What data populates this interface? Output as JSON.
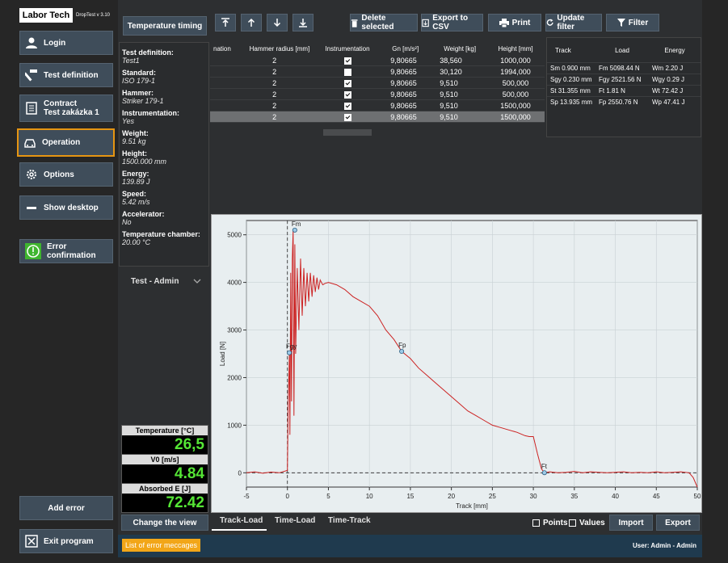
{
  "app": {
    "logo": "Labor Tech",
    "version": "DropTest v 3.10"
  },
  "nav": {
    "login": "Login",
    "test_definition": "Test definition",
    "contract_line1": "Contract",
    "contract_line2": "Test zakázka 1",
    "operation": "Operation",
    "options": "Options",
    "show_desktop": "Show desktop",
    "error_confirmation": "Error confirmation",
    "add_error": "Add error",
    "exit_program": "Exit program"
  },
  "toolbar": {
    "temperature_timing": "Temperature timing",
    "delete_selected": "Delete selected",
    "export_csv": "Export to CSV",
    "print": "Print",
    "update_filter": "Update filter",
    "filter": "Filter"
  },
  "test_info": [
    {
      "label": "Test definition:",
      "value": "Test1"
    },
    {
      "label": "Standard:",
      "value": "ISO 179-1"
    },
    {
      "label": "Hammer:",
      "value": "Striker 179-1"
    },
    {
      "label": "Instrumentation:",
      "value": "Yes"
    },
    {
      "label": "Weight:",
      "value": "9.51   kg"
    },
    {
      "label": "Height:",
      "value": "1500.000   mm"
    },
    {
      "label": "Energy:",
      "value": "139.89   J"
    },
    {
      "label": "Speed:",
      "value": "5.42   m/s"
    },
    {
      "label": "Accelerator:",
      "value": "No"
    },
    {
      "label": "Temperature chamber:",
      "value": "20.00 °C"
    }
  ],
  "user_select": "Test - Admin",
  "table": {
    "headers": [
      "nation",
      "Hammer radius [mm]",
      "Instrumentation",
      "Gn [m/s²]",
      "Weight [kg]",
      "Height [mm]"
    ],
    "rows": [
      {
        "radius": "2",
        "instr": true,
        "gn": "9,80665",
        "weight": "38,560",
        "height": "1000,000"
      },
      {
        "radius": "2",
        "instr": false,
        "gn": "9,80665",
        "weight": "30,120",
        "height": "1994,000"
      },
      {
        "radius": "2",
        "instr": true,
        "gn": "9,80665",
        "weight": "9,510",
        "height": "500,000"
      },
      {
        "radius": "2",
        "instr": true,
        "gn": "9,80665",
        "weight": "9,510",
        "height": "500,000"
      },
      {
        "radius": "2",
        "instr": true,
        "gn": "9,80665",
        "weight": "9,510",
        "height": "1500,000"
      },
      {
        "radius": "2",
        "instr": true,
        "gn": "9,80665",
        "weight": "9,510",
        "height": "1500,000"
      }
    ]
  },
  "results": {
    "headers": [
      "Track",
      "Load",
      "Energy"
    ],
    "rows": [
      [
        "Sm 0.900 mm",
        "Fm 5098.44 N",
        "Wm 2.20 J"
      ],
      [
        "Sgy 0.230 mm",
        "Fgy 2521.56 N",
        "Wgy 0.29 J"
      ],
      [
        "St 31.355 mm",
        "Ft 1.81 N",
        "Wt 72.42 J"
      ],
      [
        "Sp 13.935 mm",
        "Fp 2550.76 N",
        "Wp 47.41 J"
      ]
    ]
  },
  "meters": [
    {
      "label": "Temperature [°C]",
      "value": "26,5"
    },
    {
      "label": "V0 [m/s]",
      "value": "4.84"
    },
    {
      "label": "Absorbed E [J]",
      "value": "72.42"
    }
  ],
  "bottom": {
    "change_view": "Change the view",
    "tabs": [
      "Track-Load",
      "Time-Load",
      "Time-Track"
    ],
    "points": "Points",
    "values": "Values",
    "import": "Import",
    "export": "Export",
    "error_messages": "List of error meccages",
    "user_status": "User: Admin  -  Admin"
  },
  "chart_data": {
    "type": "line",
    "xlabel": "Track [mm]",
    "ylabel": "Load [N]",
    "xlim": [
      -5,
      50
    ],
    "ylim": [
      -300,
      5300
    ],
    "xticks": [
      -5,
      0,
      5,
      10,
      15,
      20,
      25,
      30,
      35,
      40,
      45,
      50
    ],
    "yticks": [
      0,
      1000,
      2000,
      3000,
      4000,
      5000
    ],
    "series_color": "#cc2222",
    "x": [
      -5,
      -4,
      -3,
      -2,
      -1,
      0,
      0.1,
      0.2,
      0.23,
      0.3,
      0.4,
      0.5,
      0.6,
      0.7,
      0.8,
      0.9,
      1.0,
      1.2,
      1.4,
      1.6,
      1.8,
      2.0,
      2.2,
      2.4,
      2.6,
      2.8,
      3.0,
      3.2,
      3.4,
      3.6,
      3.8,
      4.0,
      4.3,
      4.6,
      5,
      6,
      7,
      8,
      9,
      10,
      11,
      12,
      13,
      13.935,
      15,
      16,
      17,
      18,
      19,
      20,
      21,
      22,
      23,
      24,
      25,
      26,
      27,
      28,
      29,
      29.5,
      30,
      30.5,
      31,
      31.355,
      32,
      33,
      34,
      35,
      36,
      37,
      38,
      39,
      40,
      41,
      42,
      43,
      44,
      45,
      46,
      47,
      48,
      49,
      49.5,
      50
    ],
    "y": [
      0,
      20,
      -10,
      15,
      0,
      50,
      1500,
      2200,
      2521.56,
      800,
      4200,
      1500,
      4500,
      5098.44,
      1200,
      4800,
      2500,
      4300,
      3000,
      4500,
      3300,
      4300,
      3500,
      4200,
      3600,
      4200,
      3700,
      4150,
      3800,
      4100,
      3850,
      4050,
      3950,
      3980,
      4000,
      3950,
      3850,
      3700,
      3600,
      3500,
      3300,
      3000,
      2800,
      2550.76,
      2400,
      2200,
      2050,
      1900,
      1750,
      1600,
      1450,
      1300,
      1200,
      1100,
      1000,
      950,
      900,
      850,
      780,
      760,
      760,
      400,
      80,
      1.81,
      20,
      0,
      10,
      30,
      0,
      20,
      10,
      0,
      10,
      20,
      0,
      10,
      0,
      20,
      0,
      10,
      20,
      0,
      -100,
      -300
    ],
    "annotations": [
      {
        "label": "Fm",
        "x": 0.9,
        "y": 5098.44
      },
      {
        "label": "Fgy",
        "x": 0.23,
        "y": 2521.56
      },
      {
        "label": "Fp",
        "x": 13.935,
        "y": 2550.76
      },
      {
        "label": "Ft",
        "x": 31.355,
        "y": 1.81
      }
    ]
  }
}
